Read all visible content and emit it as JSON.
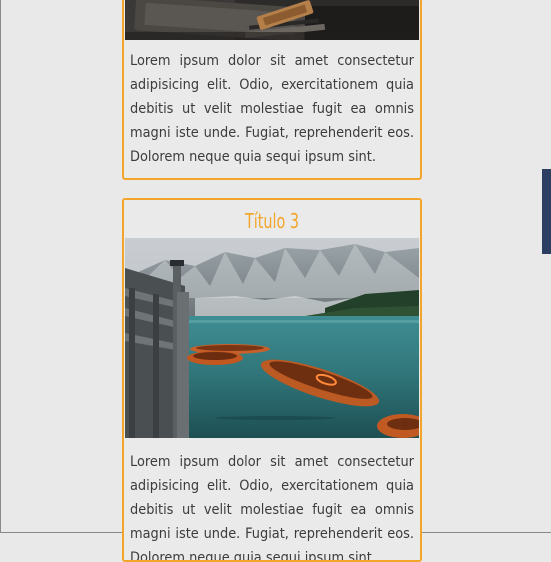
{
  "cards": [
    {
      "title": "",
      "text": "Lorem ipsum dolor sit amet consectetur adipisicing elit. Odio, exercitationem quia debitis ut velit molestiae fugit ea omnis magni iste unde. Fugiat, reprehenderit eos. Dolorem neque quia sequi ipsum sint."
    },
    {
      "title": "Título 3",
      "text": "Lorem ipsum dolor sit amet consectetur adipisicing elit. Odio, exercitationem quia debitis ut velit molestiae fugit ea omnis magni iste unde. Fugiat, reprehenderit eos. Dolorem neque quia sequi ipsum sint."
    }
  ],
  "colors": {
    "accent": "#f2a52a",
    "background": "#e9e9e9",
    "side_tab": "#2d3e63",
    "text": "#3c3c3c"
  }
}
